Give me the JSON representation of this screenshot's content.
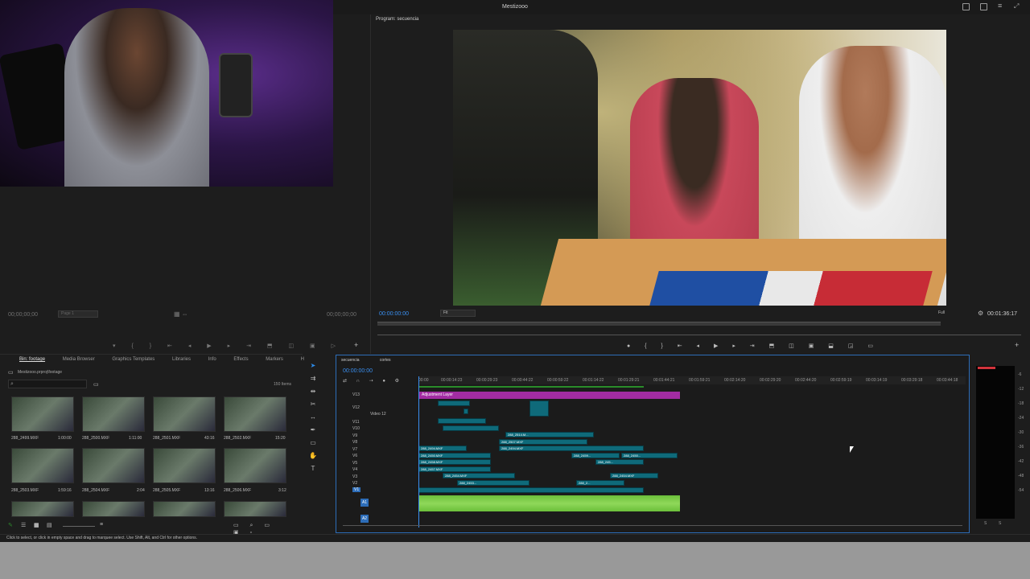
{
  "app": {
    "window_title": "Mestizooo",
    "status_hint": "Click to select, or click in empty space and drag to marquee select. Use Shift, Alt, and Ctrl for other options."
  },
  "source_monitor": {
    "timecode_in": "00;00;00;00",
    "timecode_out": "00;00;00;00",
    "page_select": "Page 1"
  },
  "program_monitor": {
    "title": "Program: secuencia",
    "timecode": "00:00:00:00",
    "fit": "Fit",
    "quality": "Full",
    "duration": "00:01:36:17"
  },
  "project": {
    "tabs": [
      {
        "label": "Bin: footage"
      },
      {
        "label": "Media Browser"
      },
      {
        "label": "Graphics Templates"
      },
      {
        "label": "Libraries"
      },
      {
        "label": "Info"
      },
      {
        "label": "Effects"
      },
      {
        "label": "Markers"
      },
      {
        "label": "History"
      }
    ],
    "path": "Mestizooo.prproj\\footage",
    "items_count": "150 Items",
    "clips": [
      {
        "name": "288_2499.MXF",
        "duration": "1:00:00"
      },
      {
        "name": "288_2500.MXF",
        "duration": "1:11:00"
      },
      {
        "name": "288_2501.MXF",
        "duration": "43:16"
      },
      {
        "name": "288_2502.MXF",
        "duration": "15:20"
      },
      {
        "name": "288_2503.MXF",
        "duration": "1:59:16"
      },
      {
        "name": "288_2504.MXF",
        "duration": "2:04"
      },
      {
        "name": "288_2505.MXF",
        "duration": "13:16"
      },
      {
        "name": "288_2506.MXF",
        "duration": "3:12"
      },
      {
        "name": "",
        "duration": ""
      },
      {
        "name": "",
        "duration": ""
      },
      {
        "name": "",
        "duration": ""
      },
      {
        "name": "",
        "duration": ""
      }
    ]
  },
  "timeline": {
    "tabs": [
      "secuencia",
      "cortes"
    ],
    "timecode": "00:00:00:00",
    "ruler": [
      "00:00",
      "00:00:14:23",
      "00:00:29:23",
      "00:00:44:22",
      "00:00:59:22",
      "00:01:14:22",
      "00:01:29:21",
      "00:01:44:21",
      "00:01:59:21",
      "00:02:14:20",
      "00:02:29:20",
      "00:02:44:20",
      "00:02:59:19",
      "00:03:14:19",
      "00:03:29:18",
      "00:03:44:18"
    ],
    "tracks": [
      "V13",
      "V12",
      "Video 12",
      "V11",
      "V10",
      "V9",
      "V8",
      "V7",
      "V6",
      "V5",
      "V4",
      "V3",
      "V2",
      "V1"
    ],
    "audio_tracks": [
      "A1",
      "A2"
    ],
    "adjustment_layer": "Adjustment Layer",
    "clip_labels": [
      "288_2514.M...",
      "288_2507.MXF",
      "288_2494.MXF",
      "288_2494.MXF",
      "288_2450.MXF",
      "288_2459...",
      "288_2450...",
      "288_2458.MXF",
      "288_245...",
      "288_2457.MXF",
      "288_2454.MXF",
      "288_2454.MXF",
      "288_2453...",
      "288_2..."
    ]
  },
  "meters": {
    "scale": [
      "-6",
      "-12",
      "-18",
      "-24",
      "-30",
      "-36",
      "-42",
      "-48",
      "-54"
    ],
    "solo": [
      "S",
      "S"
    ]
  }
}
